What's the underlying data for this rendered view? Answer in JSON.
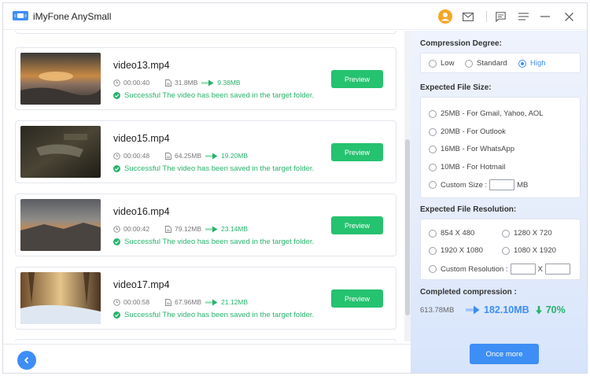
{
  "window": {
    "title": "iMyFone AnySmall"
  },
  "videos": [
    {
      "name": "video13.mp4",
      "duration": "00:00:40",
      "original_size": "31.8MB",
      "new_size": "9.38MB",
      "status": "Successful The video has been saved in the target folder.",
      "preview_label": "Preview"
    },
    {
      "name": "video15.mp4",
      "duration": "00:00:48",
      "original_size": "64.25MB",
      "new_size": "19.20MB",
      "status": "Successful The video has been saved in the target folder.",
      "preview_label": "Preview"
    },
    {
      "name": "video16.mp4",
      "duration": "00:00:42",
      "original_size": "79.12MB",
      "new_size": "23.14MB",
      "status": "Successful The video has been saved in the target folder.",
      "preview_label": "Preview"
    },
    {
      "name": "video17.mp4",
      "duration": "00:00:58",
      "original_size": "67.96MB",
      "new_size": "21.12MB",
      "status": "Successful The video has been saved in the target folder.",
      "preview_label": "Preview"
    }
  ],
  "compression": {
    "degree_title": "Compression Degree:",
    "degrees": [
      "Low",
      "Standard",
      "High"
    ],
    "degree_selected": "High",
    "size_title": "Expected File Size:",
    "sizes": [
      "25MB - For Gmail, Yahoo, AOL",
      "20MB - For Outlook",
      "16MB - For WhatsApp",
      "10MB - For Hotmail"
    ],
    "custom_size_label": "Custom Size :",
    "custom_size_unit": "MB",
    "resolution_title": "Expected File Resolution:",
    "resolutions": [
      "854 X 480",
      "1280 X 720",
      "1920 X 1080",
      "1080 X 1920"
    ],
    "custom_resolution_label": "Custom Resolution :",
    "custom_resolution_sep": "X"
  },
  "completed": {
    "title": "Completed compression :",
    "original_total": "613.78MB",
    "new_total": "182.10MB",
    "reduction": "70%"
  },
  "actions": {
    "once_more_label": "Once more"
  },
  "colors": {
    "accent": "#3d8ef5",
    "success": "#27b36b",
    "preview_button": "#25c26f"
  },
  "icons": [
    "app-logo-icon",
    "user-avatar-icon",
    "mail-icon",
    "feedback-icon",
    "menu-icon",
    "minimize-icon",
    "close-icon",
    "clock-icon",
    "file-icon",
    "arrow-right-icon",
    "check-circle-icon",
    "back-arrow-icon",
    "arrow-down-icon"
  ]
}
